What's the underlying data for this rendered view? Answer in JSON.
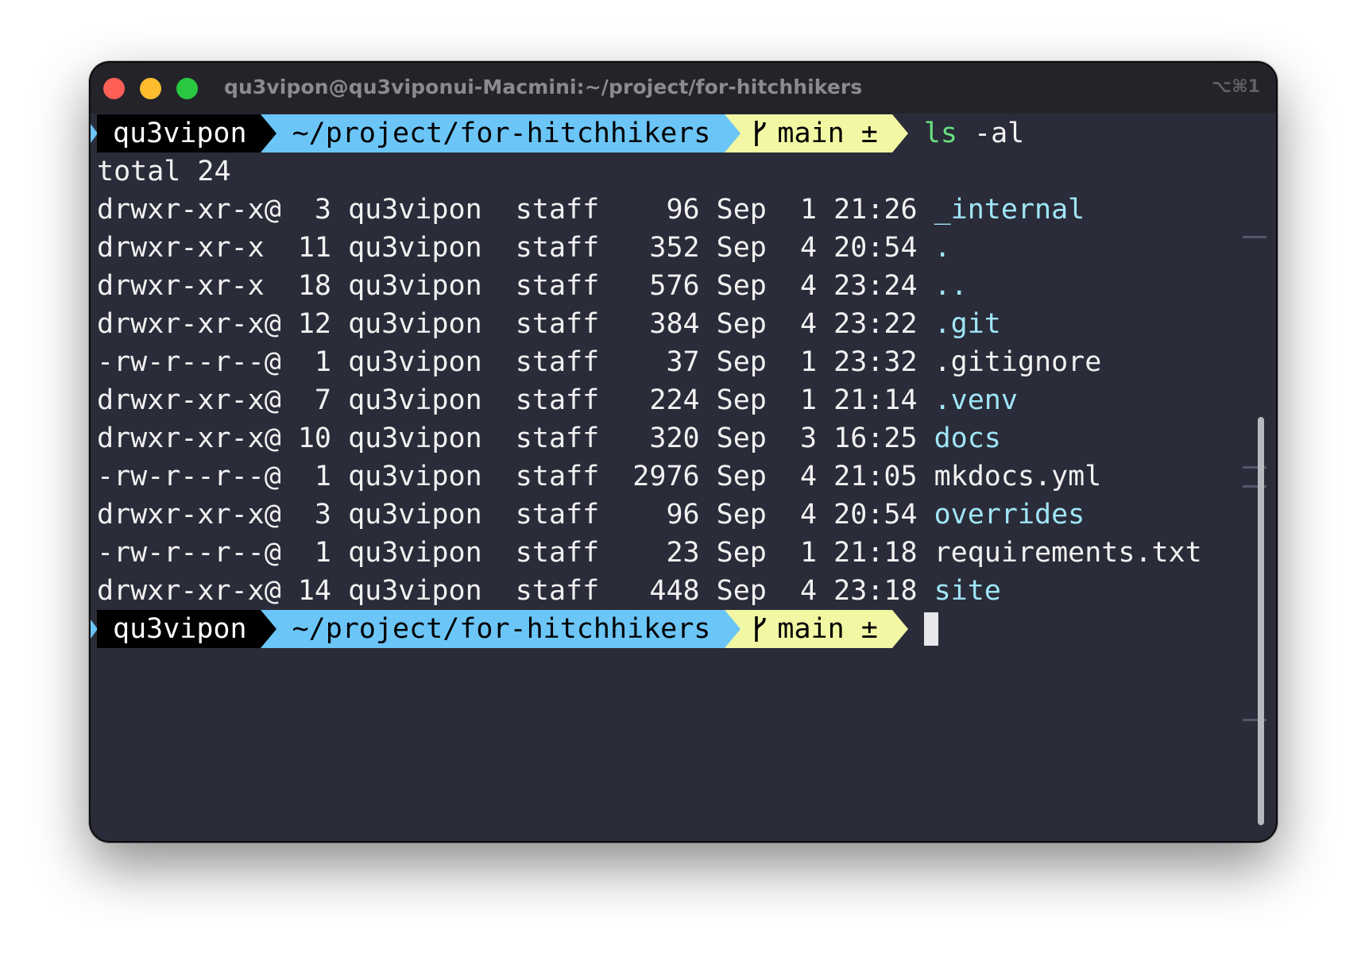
{
  "window": {
    "title": "qu3vipon@qu3viponui-Macmini:~/project/for-hitchhikers",
    "shortcut": "⌥⌘1"
  },
  "prompt": {
    "user": "qu3vipon",
    "path": "~/project/for-hitchhikers",
    "branch_icon": "git-branch-icon",
    "branch": "main ±",
    "command": "ls",
    "command_args": " -al"
  },
  "output": {
    "total": "total 24",
    "rows": [
      {
        "meta": "drwxr-xr-x@  3 qu3vipon  staff    96 Sep  1 21:26 ",
        "name": "_internal",
        "type": "dir"
      },
      {
        "meta": "drwxr-xr-x  11 qu3vipon  staff   352 Sep  4 20:54 ",
        "name": ".",
        "type": "dir"
      },
      {
        "meta": "drwxr-xr-x  18 qu3vipon  staff   576 Sep  4 23:24 ",
        "name": "..",
        "type": "dir"
      },
      {
        "meta": "drwxr-xr-x@ 12 qu3vipon  staff   384 Sep  4 23:22 ",
        "name": ".git",
        "type": "dir"
      },
      {
        "meta": "-rw-r--r--@  1 qu3vipon  staff    37 Sep  1 23:32 ",
        "name": ".gitignore",
        "type": "file"
      },
      {
        "meta": "drwxr-xr-x@  7 qu3vipon  staff   224 Sep  1 21:14 ",
        "name": ".venv",
        "type": "dir"
      },
      {
        "meta": "drwxr-xr-x@ 10 qu3vipon  staff   320 Sep  3 16:25 ",
        "name": "docs",
        "type": "dir"
      },
      {
        "meta": "-rw-r--r--@  1 qu3vipon  staff  2976 Sep  4 21:05 ",
        "name": "mkdocs.yml",
        "type": "file"
      },
      {
        "meta": "drwxr-xr-x@  3 qu3vipon  staff    96 Sep  4 20:54 ",
        "name": "overrides",
        "type": "dir"
      },
      {
        "meta": "-rw-r--r--@  1 qu3vipon  staff    23 Sep  1 21:18 ",
        "name": "requirements.txt",
        "type": "file"
      },
      {
        "meta": "drwxr-xr-x@ 14 qu3vipon  staff   448 Sep  4 23:18 ",
        "name": "site",
        "type": "dir"
      }
    ]
  },
  "colors": {
    "background": "#2b2c39",
    "path_segment": "#6cc5f7",
    "git_segment": "#f2f7a4",
    "directory": "#9fe6f7",
    "command": "#66e080"
  }
}
